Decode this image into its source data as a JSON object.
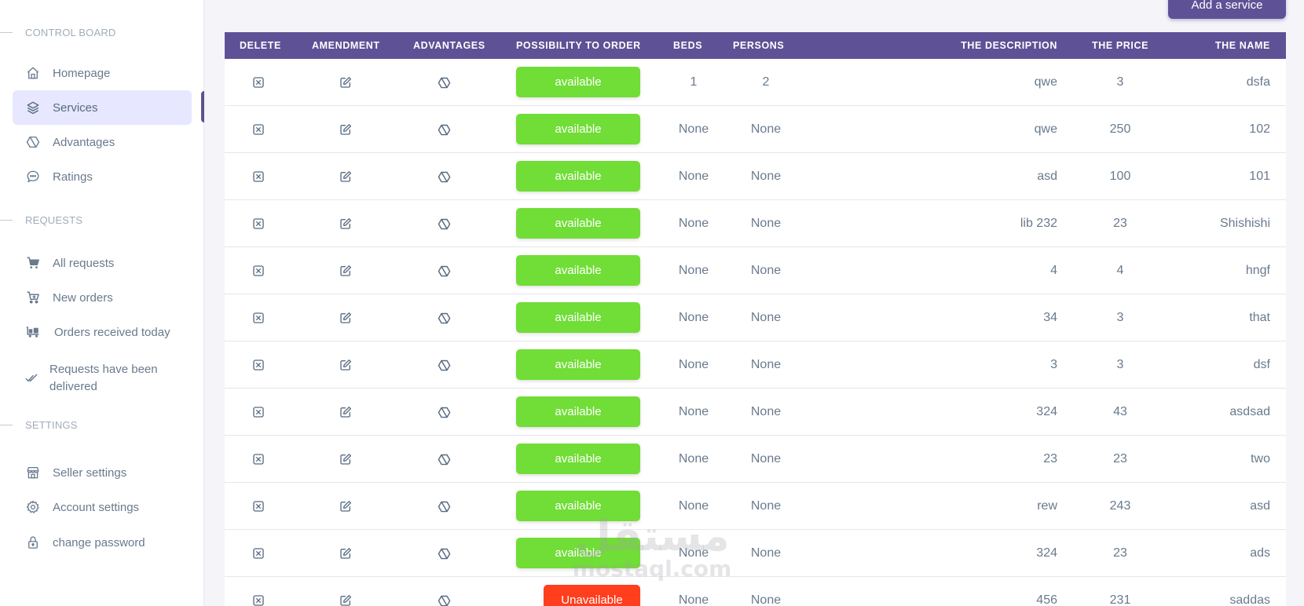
{
  "sidebar": {
    "sections": [
      {
        "title": "CONTROL BOARD"
      },
      {
        "title": "REQUESTS"
      },
      {
        "title": "SETTINGS"
      }
    ],
    "items": [
      {
        "label": "Homepage",
        "icon": "home-icon"
      },
      {
        "label": "Services",
        "icon": "layers-icon",
        "active": true
      },
      {
        "label": "Advantages",
        "icon": "hexagon-icon"
      },
      {
        "label": "Ratings",
        "icon": "chat-icon"
      },
      {
        "label": "All requests",
        "icon": "cart-icon"
      },
      {
        "label": "New orders",
        "icon": "cart-plus-icon"
      },
      {
        "label": "Orders received today",
        "icon": "truck-icon"
      },
      {
        "label": "Requests have been delivered",
        "icon": "double-check-icon"
      },
      {
        "label": "Seller settings",
        "icon": "store-icon"
      },
      {
        "label": "Account settings",
        "icon": "gear-icon"
      },
      {
        "label": "change password",
        "icon": "lock-icon"
      }
    ]
  },
  "toolbar": {
    "add_label": "Add a service"
  },
  "table": {
    "headers": {
      "delete": "DELETE",
      "amendment": "AMENDMENT",
      "advantages": "ADVANTAGES",
      "possibility": "POSSIBILITY TO ORDER",
      "beds": "BEDS",
      "persons": "PERSONS",
      "description": "THE DESCRIPTION",
      "price": "THE PRICE",
      "name": "THE NAME"
    },
    "rows": [
      {
        "status": "available",
        "beds": "1",
        "persons": "2",
        "description": "qwe",
        "price": "3",
        "name": "dsfa"
      },
      {
        "status": "available",
        "beds": "None",
        "persons": "None",
        "description": "qwe",
        "price": "250",
        "name": "102"
      },
      {
        "status": "available",
        "beds": "None",
        "persons": "None",
        "description": "asd",
        "price": "100",
        "name": "101"
      },
      {
        "status": "available",
        "beds": "None",
        "persons": "None",
        "description": "lib 232",
        "price": "23",
        "name": "Shishishi"
      },
      {
        "status": "available",
        "beds": "None",
        "persons": "None",
        "description": "4",
        "price": "4",
        "name": "hngf"
      },
      {
        "status": "available",
        "beds": "None",
        "persons": "None",
        "description": "34",
        "price": "3",
        "name": "that"
      },
      {
        "status": "available",
        "beds": "None",
        "persons": "None",
        "description": "3",
        "price": "3",
        "name": "dsf"
      },
      {
        "status": "available",
        "beds": "None",
        "persons": "None",
        "description": "324",
        "price": "43",
        "name": "asdsad"
      },
      {
        "status": "available",
        "beds": "None",
        "persons": "None",
        "description": "23",
        "price": "23",
        "name": "two"
      },
      {
        "status": "available",
        "beds": "None",
        "persons": "None",
        "description": "rew",
        "price": "243",
        "name": "asd"
      },
      {
        "status": "available",
        "beds": "None",
        "persons": "None",
        "description": "324",
        "price": "23",
        "name": "ads"
      },
      {
        "status": "Unavailable",
        "beds": "None",
        "persons": "None",
        "description": "456",
        "price": "231",
        "name": "saddas"
      }
    ]
  },
  "watermark": {
    "arabic": "مستقل",
    "latin": "mostaql.com"
  },
  "colors": {
    "brand": "#5f5196",
    "available": "#71dd37",
    "unavailable": "#ff3e1d",
    "active_bg": "#e7e7ff"
  }
}
